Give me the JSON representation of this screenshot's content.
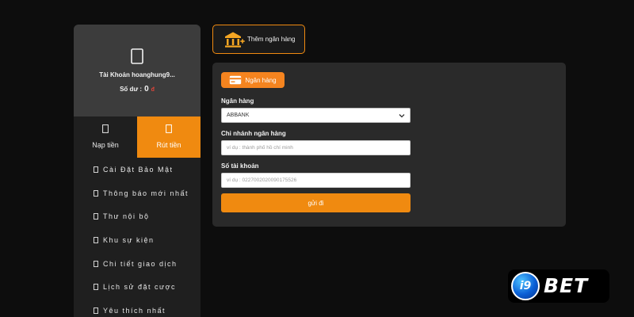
{
  "colors": {
    "accent": "#f08a10",
    "panel_bg": "#2a2a2a",
    "sidebar_bg": "#1f1f1f",
    "account_bg": "#3c3c3c",
    "page_bg": "#0d0d0d",
    "currency": "#e0453a"
  },
  "account": {
    "icon": "phone-icon",
    "name": "Tài Khoản hoanghung9...",
    "balance_label": "Số dư :",
    "balance_value": "0",
    "balance_currency": "đ"
  },
  "tabs": [
    {
      "label": "Nạp tiền",
      "icon": "deposit-icon",
      "active": false
    },
    {
      "label": "Rút tiền",
      "icon": "withdraw-icon",
      "active": true
    }
  ],
  "menu": [
    {
      "label": "Cài Đặt Bảo Mật",
      "icon": "shield-icon"
    },
    {
      "label": "Thông báo mới nhất",
      "icon": "bell-icon"
    },
    {
      "label": "Thư nội bộ",
      "icon": "mail-icon"
    },
    {
      "label": "Khu sự kiện",
      "icon": "gift-icon"
    },
    {
      "label": "Chi tiết giao dịch",
      "icon": "list-icon"
    },
    {
      "label": "Lịch sử đặt cược",
      "icon": "history-icon"
    },
    {
      "label": "Yêu thích nhất",
      "icon": "heart-icon"
    }
  ],
  "toolbar": {
    "add_bank_label": "Thêm ngân hàng",
    "add_bank_icon": "bank-plus-icon"
  },
  "form": {
    "tab_label": "Ngân hàng",
    "tab_icon": "card-icon",
    "bank_label": "Ngân hàng",
    "bank_selected": "ABBANK",
    "branch_label": "Chi nhánh ngân hàng",
    "branch_placeholder": "ví dụ : thành phố hồ chí minh",
    "account_label": "Số tài khoản",
    "account_placeholder": "ví dụ : 0227002020090175526",
    "submit_label": "gửi đi"
  },
  "logo": {
    "mark": "i9",
    "text": "BET"
  }
}
